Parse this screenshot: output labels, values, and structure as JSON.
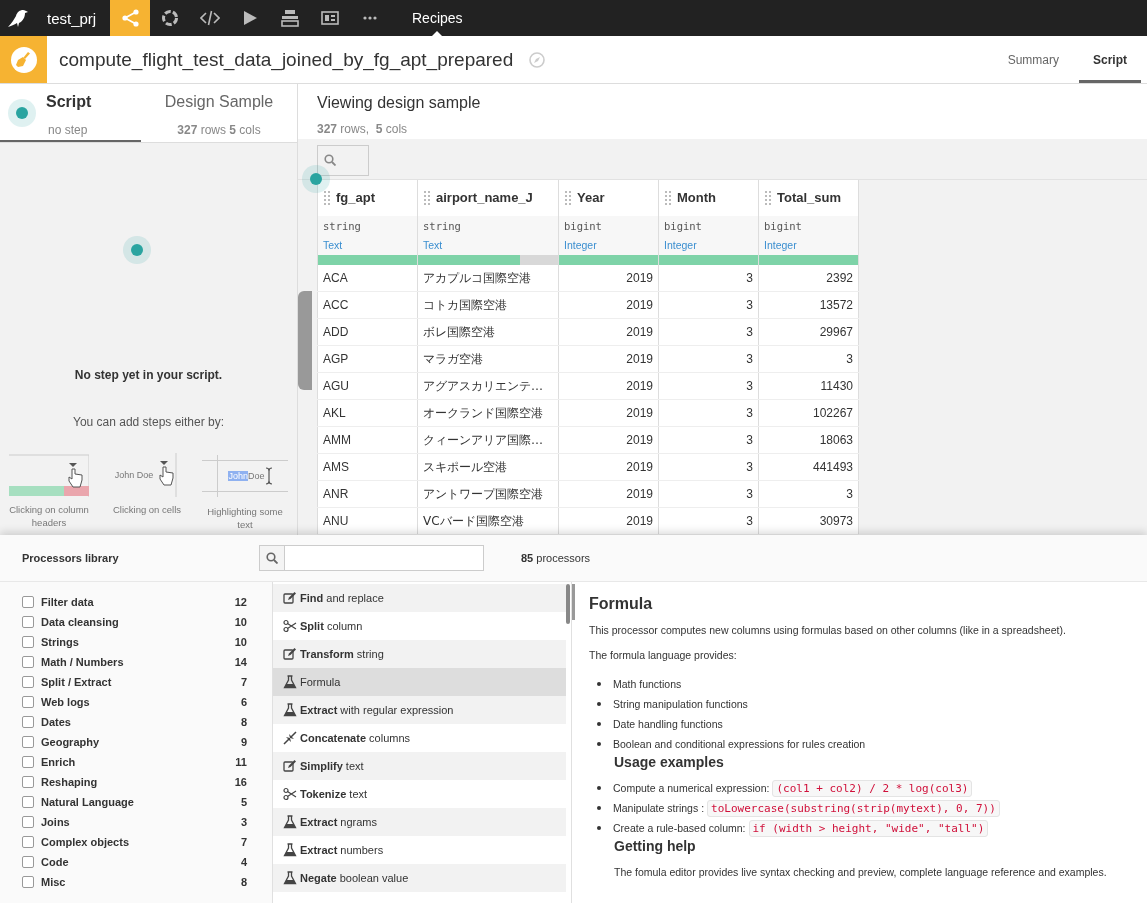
{
  "topbar": {
    "project": "test_prj",
    "nav": [
      {
        "kind": "flow",
        "selected": true
      },
      {
        "kind": "ring",
        "selected": false
      },
      {
        "kind": "code",
        "selected": false
      },
      {
        "kind": "play",
        "selected": false
      },
      {
        "kind": "stack",
        "selected": false
      },
      {
        "kind": "dashboard",
        "selected": false
      },
      {
        "kind": "more",
        "selected": false
      }
    ],
    "section": "Recipes"
  },
  "header": {
    "title": "compute_flight_test_data_joined_by_fg_apt_prepared",
    "tabs": [
      {
        "label": "Summary",
        "selected": false
      },
      {
        "label": "Script",
        "selected": true
      }
    ]
  },
  "left_panel": {
    "tabs": [
      {
        "label": "Script",
        "sub": "no step",
        "selected": true
      },
      {
        "label": "Design Sample",
        "sub": "**327** rows **5** cols",
        "selected": false
      }
    ],
    "empty_title": "No step yet in your script.",
    "hint": "You can add steps either by:",
    "methods": [
      {
        "kind": "header",
        "caption": "Clicking on column headers"
      },
      {
        "kind": "cell",
        "sample": "John Doe",
        "caption": "Clicking on cells"
      },
      {
        "kind": "highlight",
        "highlight": "John",
        "rest": " Doe",
        "caption": "Highlighting some text"
      }
    ]
  },
  "viewer": {
    "title": "Viewing design sample",
    "summary": "**327** rows,  **5** cols",
    "columns": [
      {
        "name": "fg_apt",
        "storage": "string",
        "meaning": "Text",
        "level": 1,
        "kind": "text"
      },
      {
        "name": "airport_name_J",
        "storage": "string",
        "meaning": "Text",
        "level": 0.73,
        "kind": "text"
      },
      {
        "name": "Year",
        "storage": "bigint",
        "meaning": "Integer",
        "level": 1,
        "kind": "number"
      },
      {
        "name": "Month",
        "storage": "bigint",
        "meaning": "Integer",
        "level": 1,
        "kind": "number"
      },
      {
        "name": "Total_sum",
        "storage": "bigint",
        "meaning": "Integer",
        "level": 1,
        "kind": "number"
      }
    ],
    "rows": [
      [
        "ACA",
        "アカプルコ国際空港",
        "2019",
        "3",
        "2392"
      ],
      [
        "ACC",
        "コトカ国際空港",
        "2019",
        "3",
        "13572"
      ],
      [
        "ADD",
        "ボレ国際空港",
        "2019",
        "3",
        "29967"
      ],
      [
        "AGP",
        "マラガ空港",
        "2019",
        "3",
        "3"
      ],
      [
        "AGU",
        "アグアスカリエンテ…",
        "2019",
        "3",
        "11430"
      ],
      [
        "AKL",
        "オークランド国際空港",
        "2019",
        "3",
        "102267"
      ],
      [
        "AMM",
        "クィーンアリア国際…",
        "2019",
        "3",
        "18063"
      ],
      [
        "AMS",
        "スキポール空港",
        "2019",
        "3",
        "441493"
      ],
      [
        "ANR",
        "アントワープ国際空港",
        "2019",
        "3",
        "3"
      ],
      [
        "ANU",
        "VCバード国際空港",
        "2019",
        "3",
        "30973"
      ]
    ]
  },
  "library": {
    "title": "Processors library",
    "count": "**85** processors",
    "categories": [
      {
        "label": "Filter data",
        "count": "12",
        "checked": false
      },
      {
        "label": "Data cleansing",
        "count": "10",
        "checked": false
      },
      {
        "label": "Strings",
        "count": "10",
        "checked": false
      },
      {
        "label": "Math / Numbers",
        "count": "14",
        "checked": false
      },
      {
        "label": "Split / Extract",
        "count": "7",
        "checked": false
      },
      {
        "label": "Web logs",
        "count": "6",
        "checked": false
      },
      {
        "label": "Dates",
        "count": "8",
        "checked": false
      },
      {
        "label": "Geography",
        "count": "9",
        "checked": false
      },
      {
        "label": "Enrich",
        "count": "11",
        "checked": false
      },
      {
        "label": "Reshaping",
        "count": "16",
        "checked": false
      },
      {
        "label": "Natural Language",
        "count": "5",
        "checked": false
      },
      {
        "label": "Joins",
        "count": "3",
        "checked": false
      },
      {
        "label": "Complex objects",
        "count": "7",
        "checked": false
      },
      {
        "label": "Code",
        "count": "4",
        "checked": false
      },
      {
        "label": "Misc",
        "count": "8",
        "checked": false
      }
    ],
    "processors": [
      {
        "kind": "edit",
        "label": "**Find** and replace",
        "selected": false
      },
      {
        "kind": "scissors",
        "label": "**Split** column",
        "selected": false
      },
      {
        "kind": "edit",
        "label": "**Transform** string",
        "selected": false
      },
      {
        "kind": "flask",
        "label": "Formula",
        "selected": true
      },
      {
        "kind": "flask",
        "label": "**Extract** with regular expression",
        "selected": false
      },
      {
        "kind": "merge",
        "label": "**Concatenate** columns",
        "selected": false
      },
      {
        "kind": "edit",
        "label": "**Simplify** text",
        "selected": false
      },
      {
        "kind": "scissors",
        "label": "**Tokenize** text",
        "selected": false
      },
      {
        "kind": "flask",
        "label": "**Extract** ngrams",
        "selected": false
      },
      {
        "kind": "flask",
        "label": "**Extract** numbers",
        "selected": false
      },
      {
        "kind": "flask",
        "label": "**Negate** boolean value",
        "selected": false
      }
    ],
    "detail": {
      "title": "Formula",
      "intro": "This processor computes new columns using formulas based on other columns (like in a spreadsheet).",
      "lead": "The formula language provides:",
      "features": [
        "Math functions",
        "String manipulation functions",
        "Date handling functions",
        "Boolean and conditional expressions for rules creation"
      ],
      "usage_heading": "Usage examples",
      "examples": [
        {
          "text": "Compute a numerical expression:",
          "code": "(col1 + col2) / 2 * log(col3)"
        },
        {
          "text": "Manipulate strings :",
          "code": "toLowercase(substring(strip(mytext), 0, 7))"
        },
        {
          "text": "Create a rule-based column:",
          "code": "if (width > height, \"wide\", \"tall\")"
        }
      ],
      "help_heading": "Getting help",
      "help_text": "The fomula editor provides live syntax checking and preview, complete language reference and examples."
    }
  }
}
